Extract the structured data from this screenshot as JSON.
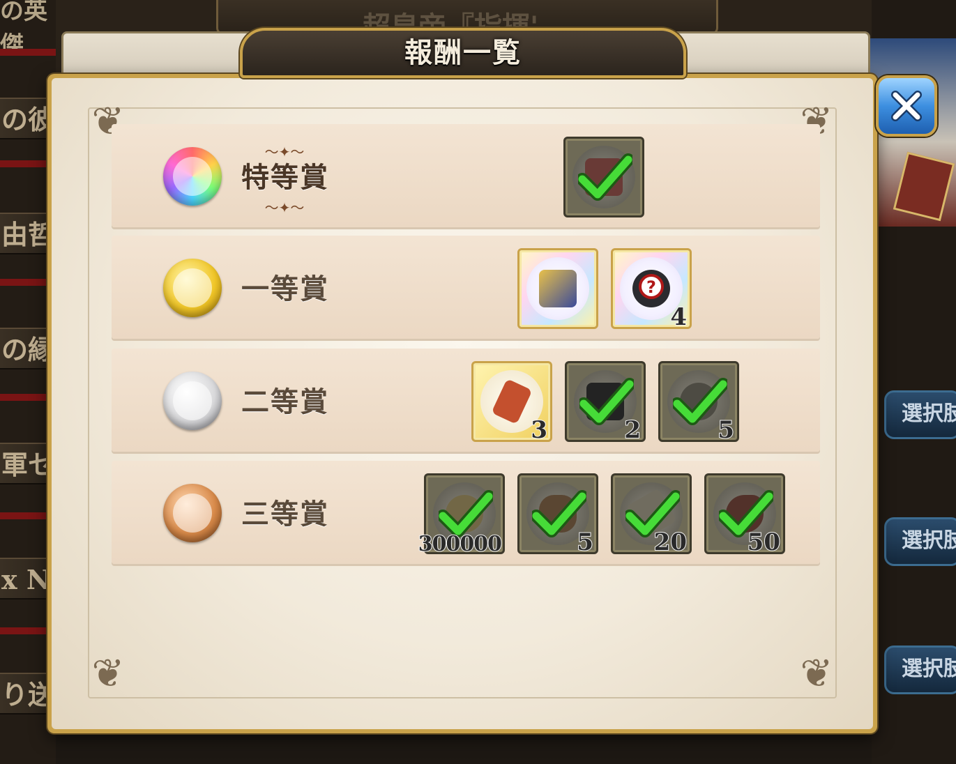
{
  "background": {
    "top_left_text": "の英傑",
    "top_banner_text": "超皇帝『指揮',",
    "left_rows": [
      "の彼ノ",
      "由哲",
      "の縁",
      "軍セ",
      "x Ni",
      "り送"
    ],
    "right_buttons": [
      "選択肢",
      "選択肢",
      "選択肢"
    ]
  },
  "modal": {
    "title": "報酬一覧",
    "close_label": "✕"
  },
  "prizes": [
    {
      "rank": "特等賞",
      "medal": "rainbow",
      "items": [
        {
          "name": "card-bundle",
          "owned": true,
          "count": ""
        }
      ]
    },
    {
      "rank": "一等賞",
      "medal": "gold",
      "items": [
        {
          "name": "treasure-chest",
          "owned": false,
          "count": ""
        },
        {
          "name": "mystery-crest",
          "owned": false,
          "count": "4"
        }
      ]
    },
    {
      "rank": "二等賞",
      "medal": "silver",
      "items": [
        {
          "name": "golden-ticket",
          "owned": false,
          "count": "3"
        },
        {
          "name": "dark-crest",
          "owned": true,
          "count": "2"
        },
        {
          "name": "ornate-ring",
          "owned": true,
          "count": "5"
        }
      ]
    },
    {
      "rank": "三等賞",
      "medal": "bronze",
      "items": [
        {
          "name": "coin-pile",
          "owned": true,
          "count": "300000"
        },
        {
          "name": "burger",
          "owned": true,
          "count": "5"
        },
        {
          "name": "scroll-ticket",
          "owned": true,
          "count": "20"
        },
        {
          "name": "meat",
          "owned": true,
          "count": "50"
        }
      ]
    }
  ],
  "colors": {
    "frame_gold": "#c9a24a",
    "check_green": "#3fd33a",
    "close_blue": "#3d8fe0"
  }
}
